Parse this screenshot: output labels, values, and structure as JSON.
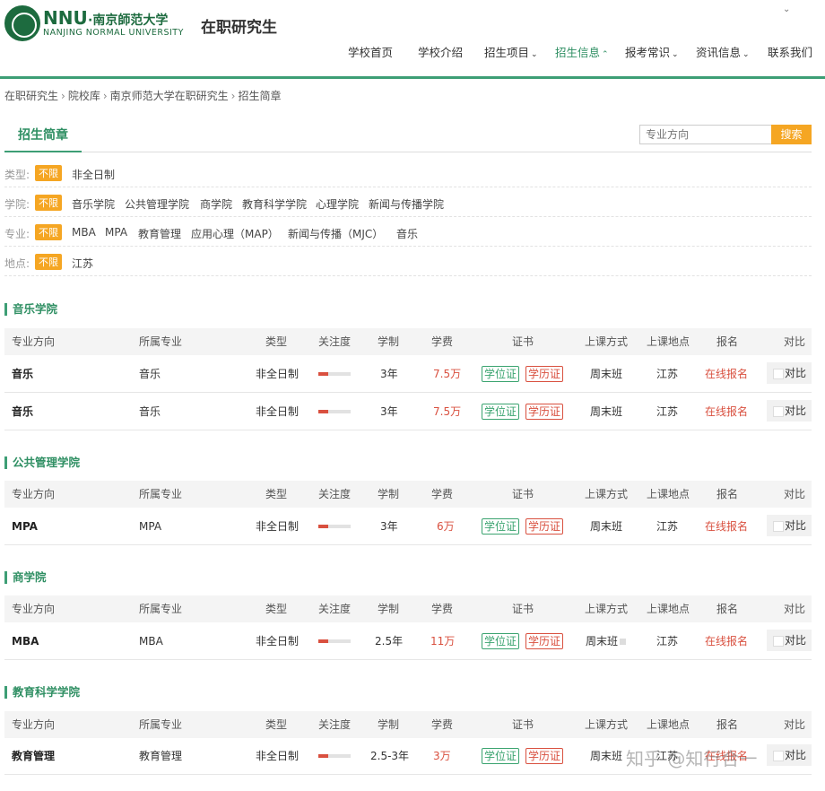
{
  "header": {
    "brand_abbr": "NNU",
    "brand_cn": "·南京師范大学",
    "brand_en": "NANJING NORMAL UNIVERSITY",
    "site_title": "在职研究生",
    "nav": [
      {
        "label": "学校首页",
        "dropdown": false,
        "active": false
      },
      {
        "label": "学校介绍",
        "dropdown": false,
        "active": false
      },
      {
        "label": "招生项目",
        "dropdown": true,
        "active": false
      },
      {
        "label": "招生信息",
        "dropdown": true,
        "active": true
      },
      {
        "label": "报考常识",
        "dropdown": true,
        "active": false
      },
      {
        "label": "资讯信息",
        "dropdown": true,
        "active": false
      },
      {
        "label": "联系我们",
        "dropdown": false,
        "active": false
      }
    ]
  },
  "breadcrumb": [
    "在职研究生",
    "院校库",
    "南京师范大学在职研究生",
    "招生简章"
  ],
  "tab": {
    "label": "招生简章"
  },
  "search": {
    "placeholder": "专业方向",
    "button": "搜索"
  },
  "filters": [
    {
      "label": "类型:",
      "badge": "不限",
      "options": [
        "非全日制"
      ]
    },
    {
      "label": "学院:",
      "badge": "不限",
      "options": [
        "音乐学院",
        "公共管理学院",
        "商学院",
        "教育科学学院",
        "心理学院",
        "新闻与传播学院"
      ]
    },
    {
      "label": "专业:",
      "badge": "不限",
      "options": [
        "MBA",
        "MPA",
        "教育管理",
        "应用心理（MAP）",
        "新闻与传播（MJC）",
        "音乐"
      ]
    },
    {
      "label": "地点:",
      "badge": "不限",
      "options": [
        "江苏"
      ]
    }
  ],
  "table_headers": {
    "direction": "专业方向",
    "major": "所属专业",
    "type": "类型",
    "attention": "关注度",
    "duration": "学制",
    "fee": "学费",
    "cert": "证书",
    "mode": "上课方式",
    "place": "上课地点",
    "register": "报名",
    "compare": "对比"
  },
  "sections": [
    {
      "title": "音乐学院",
      "rows": [
        {
          "direction": "音乐",
          "major": "音乐",
          "type": "非全日制",
          "attention": 0.3,
          "duration": "3年",
          "fee": "7.5万",
          "cert1": "学位证",
          "cert2": "学历证",
          "mode": "周末班",
          "place": "江苏",
          "register": "在线报名",
          "compare": "对比"
        },
        {
          "direction": "音乐",
          "major": "音乐",
          "type": "非全日制",
          "attention": 0.3,
          "duration": "3年",
          "fee": "7.5万",
          "cert1": "学位证",
          "cert2": "学历证",
          "mode": "周末班",
          "place": "江苏",
          "register": "在线报名",
          "compare": "对比"
        }
      ]
    },
    {
      "title": "公共管理学院",
      "rows": [
        {
          "direction": "MPA",
          "major": "MPA",
          "type": "非全日制",
          "attention": 0.3,
          "duration": "3年",
          "fee": "6万",
          "cert1": "学位证",
          "cert2": "学历证",
          "mode": "周末班",
          "place": "江苏",
          "register": "在线报名",
          "compare": "对比"
        }
      ]
    },
    {
      "title": "商学院",
      "rows": [
        {
          "direction": "MBA",
          "major": "MBA",
          "type": "非全日制",
          "attention": 0.3,
          "duration": "2.5年",
          "fee": "11万",
          "cert1": "学位证",
          "cert2": "学历证",
          "mode": "周末班",
          "place": "江苏",
          "register": "在线报名",
          "compare": "对比"
        }
      ]
    },
    {
      "title": "教育科学学院",
      "rows": [
        {
          "direction": "教育管理",
          "major": "教育管理",
          "type": "非全日制",
          "attention": 0.3,
          "duration": "2.5-3年",
          "fee": "3万",
          "cert1": "学位证",
          "cert2": "学历证",
          "mode": "周末班",
          "place": "江苏",
          "register": "在线报名",
          "compare": "对比"
        }
      ]
    }
  ],
  "watermark": "知乎 @知行合一",
  "colors": {
    "accent": "#3d9e75",
    "orange": "#f5a623",
    "red": "#d9503f"
  }
}
